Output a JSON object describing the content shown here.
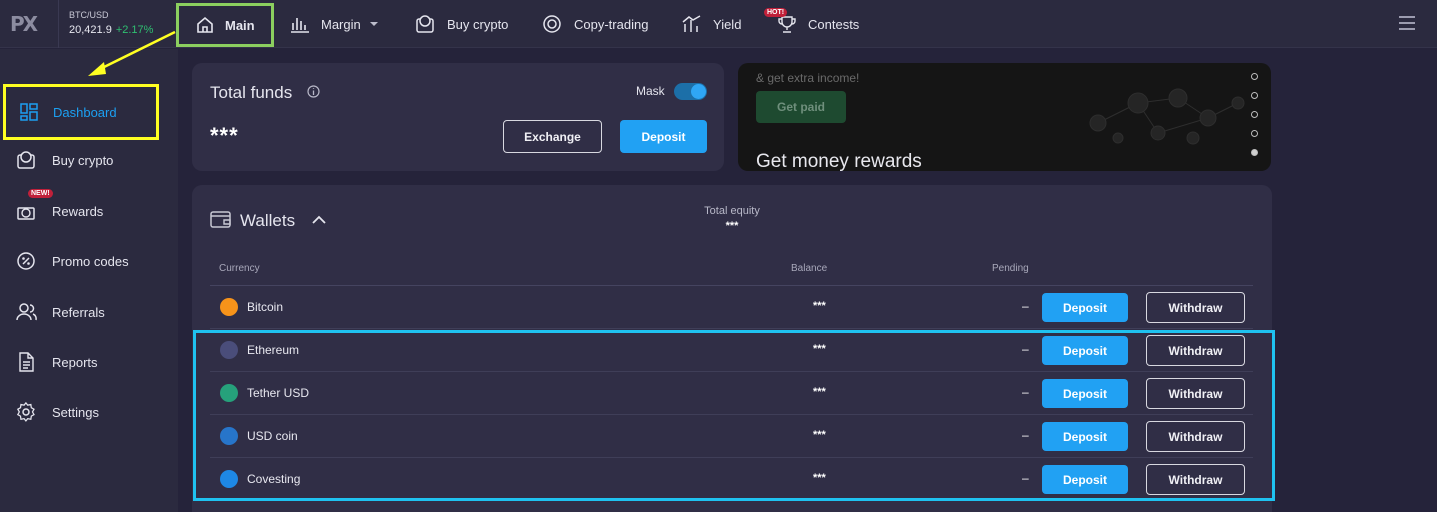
{
  "header": {
    "logo_text": "PX",
    "ticker": {
      "pair": "BTC/USD",
      "price": "20,421.9",
      "change": "+2.17%"
    },
    "nav": [
      {
        "label": "Main",
        "icon": "home-icon"
      },
      {
        "label": "Margin",
        "icon": "bar-chart-icon"
      },
      {
        "label": "Buy crypto",
        "icon": "wallet-coin-icon"
      },
      {
        "label": "Copy-trading",
        "icon": "copy-trading-icon"
      },
      {
        "label": "Yield",
        "icon": "yield-icon"
      },
      {
        "label": "Contests",
        "icon": "trophy-icon",
        "badge": "HOT!"
      }
    ]
  },
  "sidebar": {
    "items": [
      {
        "label": "Dashboard",
        "icon": "dashboard-icon",
        "active": true
      },
      {
        "label": "Buy crypto",
        "icon": "wallet-coin-icon"
      },
      {
        "label": "Rewards",
        "icon": "gift-icon",
        "badge": "NEW!"
      },
      {
        "label": "Promo codes",
        "icon": "percent-icon"
      },
      {
        "label": "Referrals",
        "icon": "users-icon"
      },
      {
        "label": "Reports",
        "icon": "document-icon"
      },
      {
        "label": "Settings",
        "icon": "gear-icon"
      }
    ]
  },
  "funds": {
    "title": "Total funds",
    "value": "***",
    "mask_label": "Mask",
    "mask_on": true,
    "exchange_label": "Exchange",
    "deposit_label": "Deposit"
  },
  "promo": {
    "subtitle": "& get extra income!",
    "button_label": "Get paid",
    "title": "Get money rewards",
    "slides": 5,
    "active_slide": 5
  },
  "wallets": {
    "title": "Wallets",
    "equity_label": "Total equity",
    "equity_value": "***",
    "columns": {
      "currency": "Currency",
      "balance": "Balance",
      "pending": "Pending"
    },
    "rows": [
      {
        "name": "Bitcoin",
        "balance": "***",
        "pending": "–",
        "deposit": "Deposit",
        "withdraw": "Withdraw",
        "color": "#f7931a"
      },
      {
        "name": "Ethereum",
        "balance": "***",
        "pending": "–",
        "deposit": "Deposit",
        "withdraw": "Withdraw",
        "color": "#627eea"
      },
      {
        "name": "Tether USD",
        "balance": "***",
        "pending": "–",
        "deposit": "Deposit",
        "withdraw": "Withdraw",
        "color": "#26a17b"
      },
      {
        "name": "USD coin",
        "balance": "***",
        "pending": "–",
        "deposit": "Deposit",
        "withdraw": "Withdraw",
        "color": "#2775ca"
      },
      {
        "name": "Covesting",
        "balance": "***",
        "pending": "–",
        "deposit": "Deposit",
        "withdraw": "Withdraw",
        "color": "#1e88e5"
      }
    ]
  },
  "colors": {
    "accent": "#21a1f3",
    "positive": "#2fbf71",
    "highlight_green": "#8ccf5f",
    "highlight_yellow": "#ffff22",
    "highlight_cyan": "#1fc2f0"
  }
}
